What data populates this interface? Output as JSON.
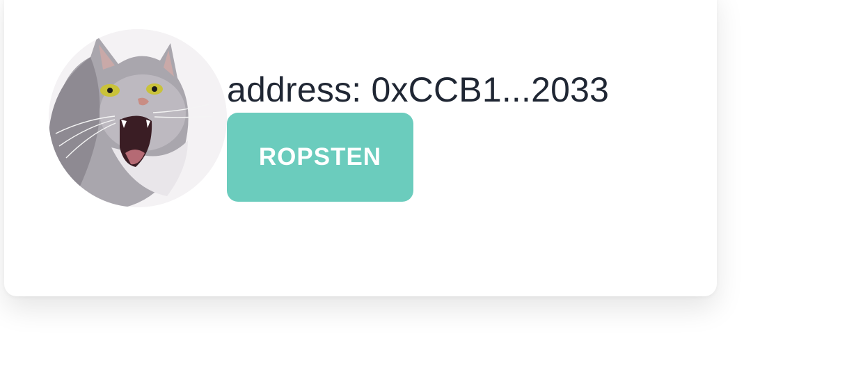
{
  "account": {
    "avatar_icon": "cat-avatar-icon",
    "address_text": "address: 0xCCB1...2033"
  },
  "network": {
    "label": "ROPSTEN",
    "color": "#6bccbd"
  },
  "colors": {
    "text": "#1f2633",
    "card_background": "#ffffff"
  }
}
